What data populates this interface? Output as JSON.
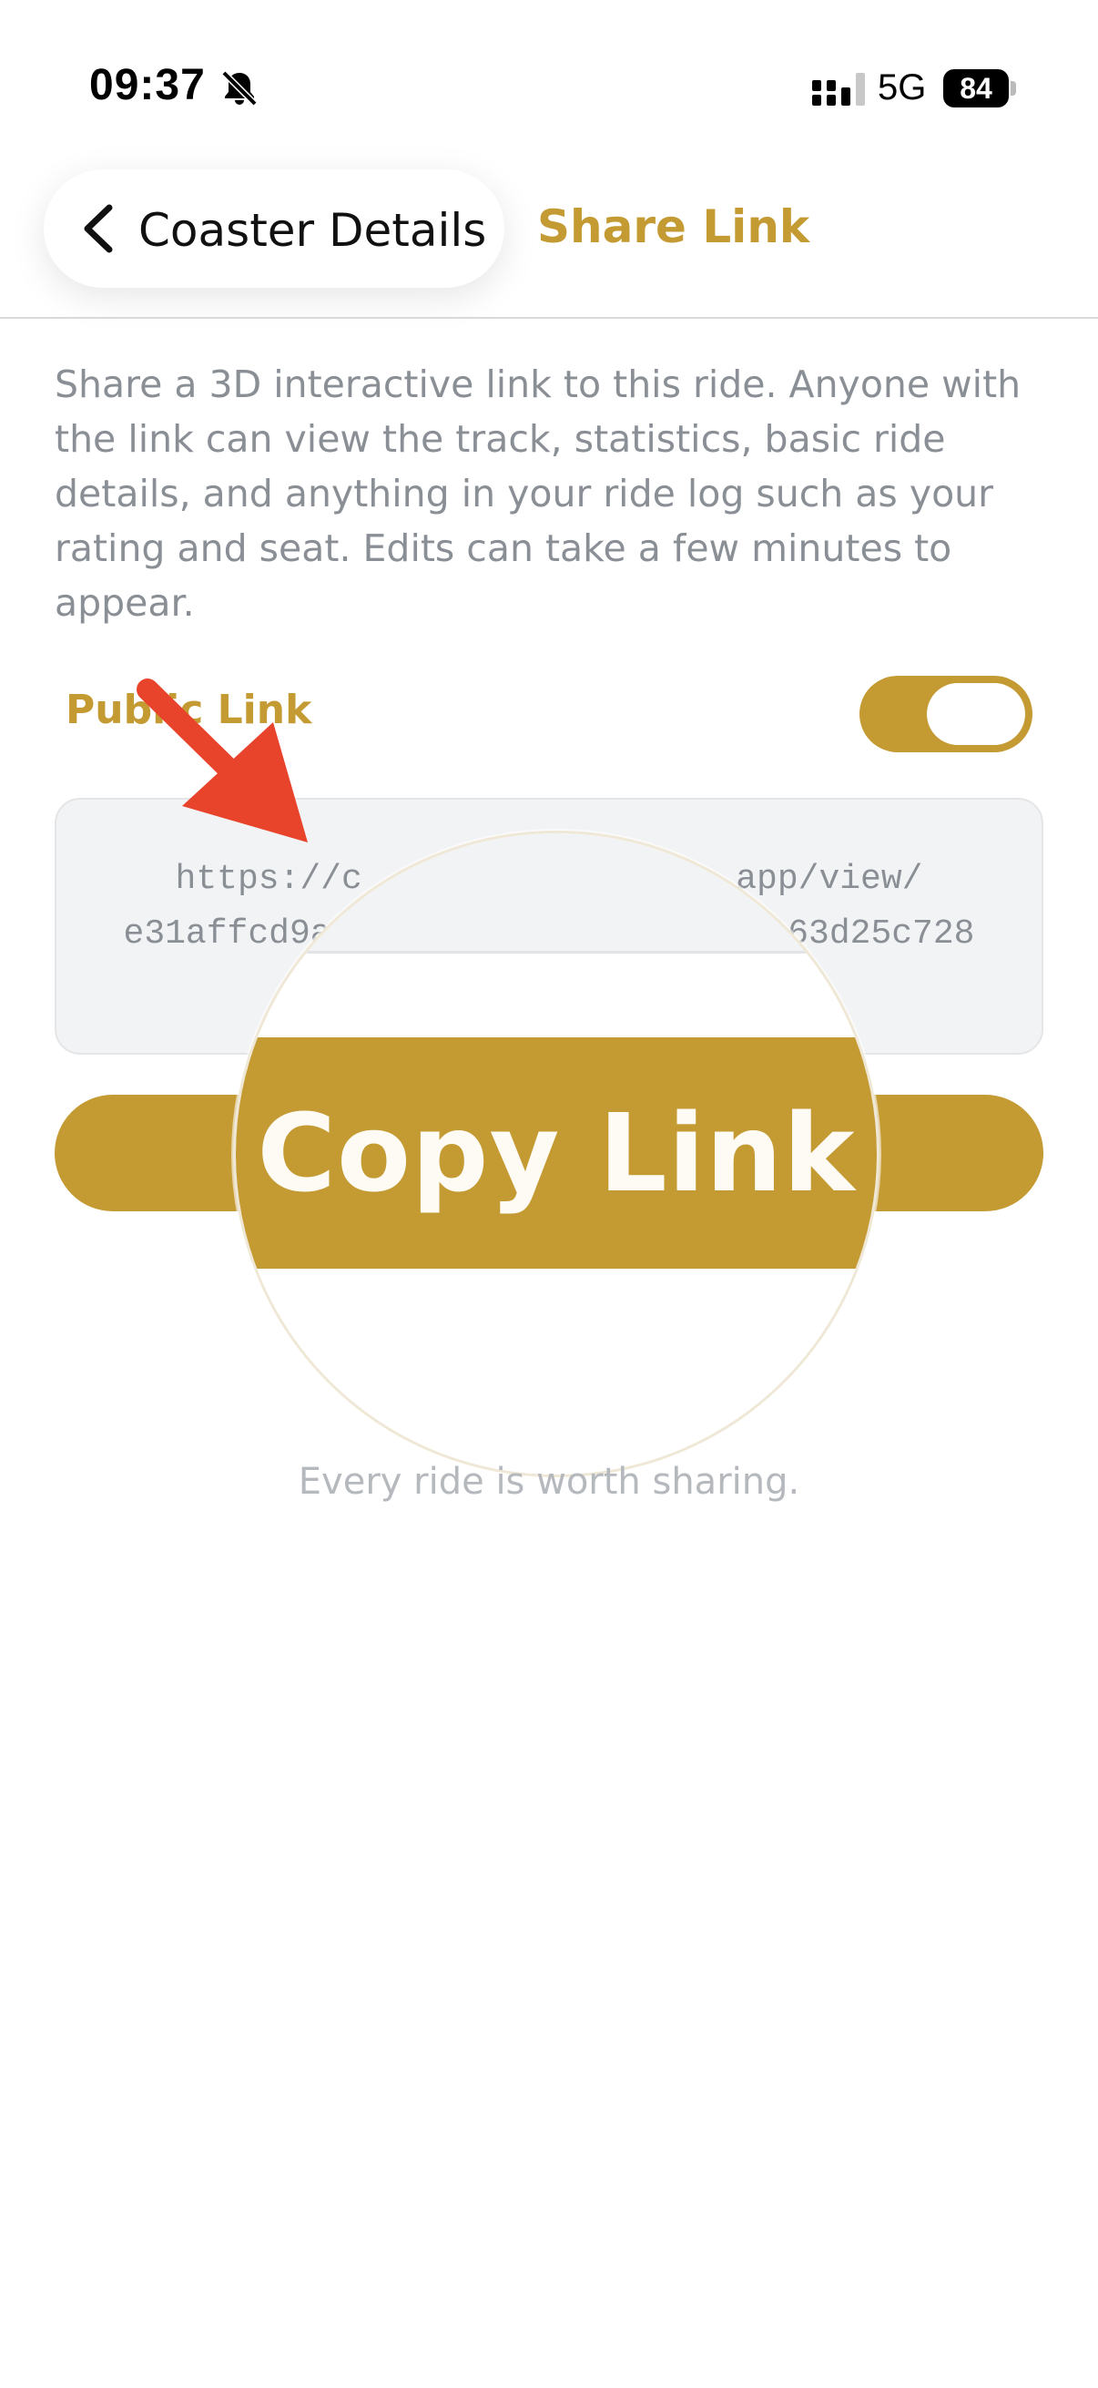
{
  "status_bar": {
    "time": "09:37",
    "network": "5G",
    "battery": "84"
  },
  "header": {
    "back_label": "Coaster Details",
    "title": "Share Link"
  },
  "description": "Share a 3D interactive link to this ride. Anyone with the link can view the track, statistics, basic ride details, and anything in your ride log such as your rating and seat. Edits can take a few minutes to appear.",
  "public_link": {
    "label": "Public Link",
    "enabled": true
  },
  "url": {
    "line1": "https://c                  app/view/",
    "line2": "e31affcd9aa                    163d25c728"
  },
  "copy_button": {
    "label": "Copy Link"
  },
  "tagline": "Every ride is worth sharing.",
  "colors": {
    "accent": "#c49a33",
    "muted_text": "#8a8f96",
    "arrow": "#e8432b"
  },
  "icons": {
    "back": "chevron-left-icon",
    "silent": "bell-slash-icon",
    "signal": "signal-icon"
  }
}
